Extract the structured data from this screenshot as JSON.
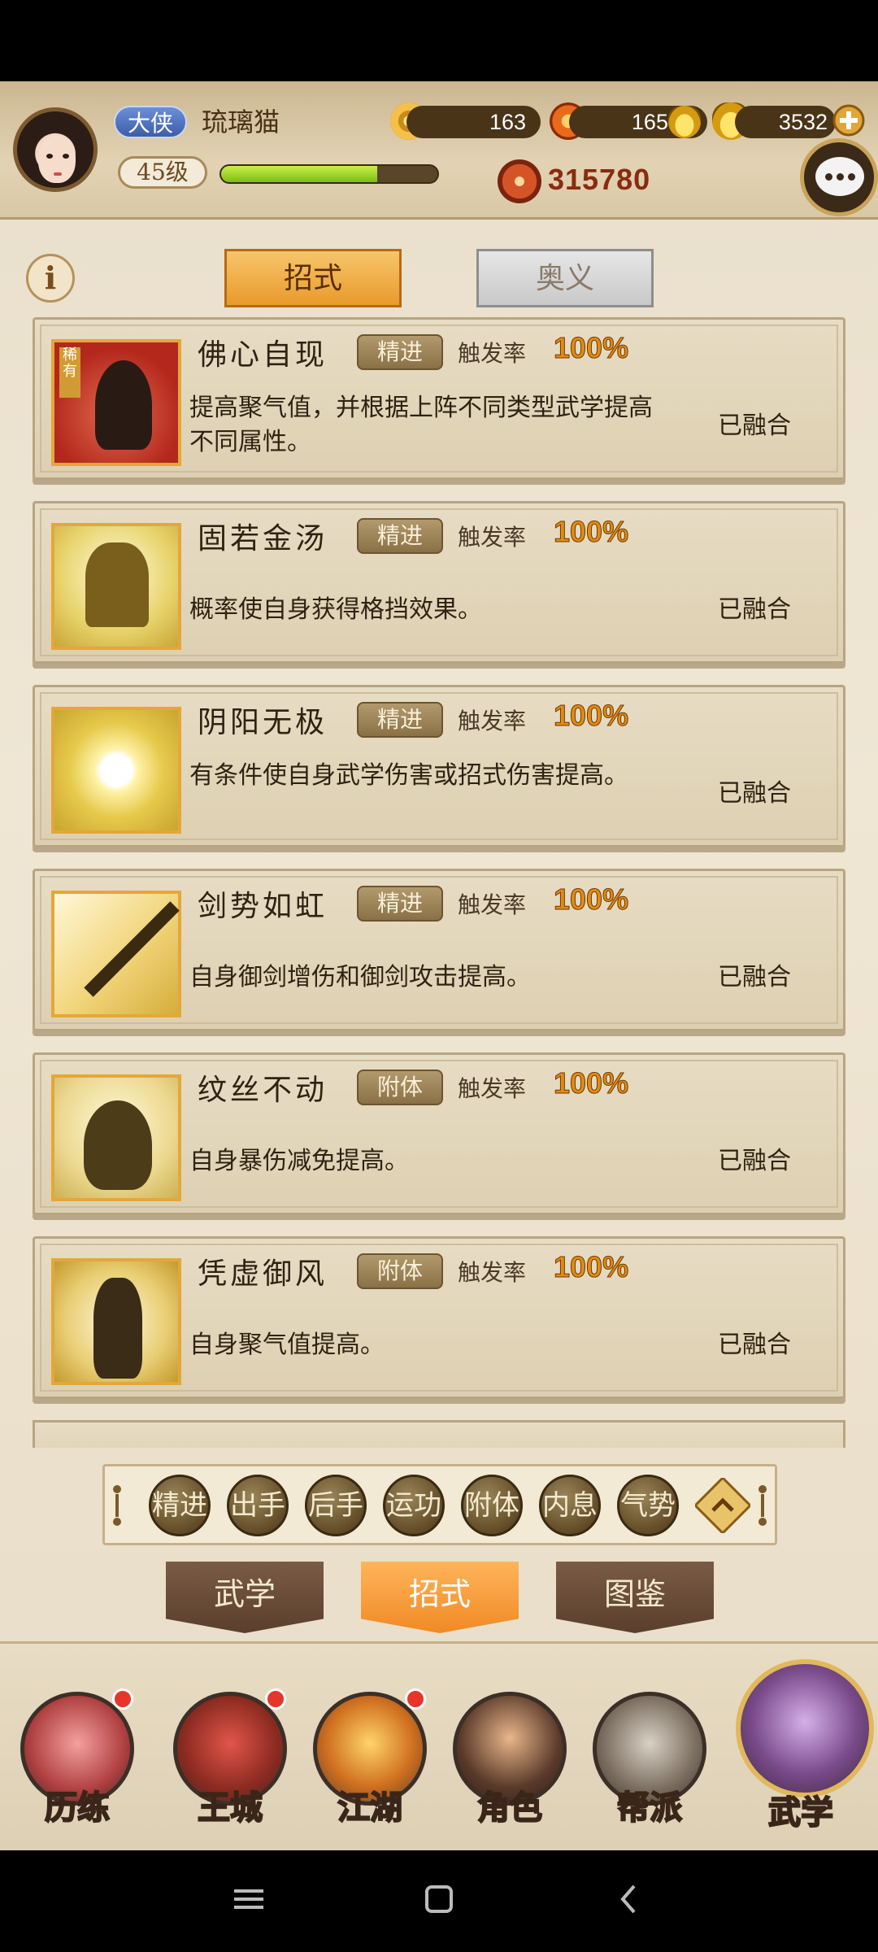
{
  "player": {
    "rank": "大侠",
    "name": "琉璃猫",
    "level": "45级",
    "exp_fraction": 0.72,
    "power": "315780"
  },
  "resources": {
    "coins": "163",
    "gems": "16502",
    "gold": "3532"
  },
  "tabs": {
    "top": [
      "招式",
      "奥义"
    ],
    "top_active": "招式"
  },
  "skills": [
    {
      "name": "佛心自现",
      "type": "精进",
      "trigger_label": "触发率",
      "trigger_value": "100%",
      "description": "提高聚气值，并根据上阵不同类型武学提高不同属性。",
      "status": "已融合",
      "rarity": "稀有",
      "icon": "praying-hands-icon"
    },
    {
      "name": "固若金汤",
      "type": "精进",
      "trigger_label": "触发率",
      "trigger_value": "100%",
      "description": "概率使自身获得格挡效果。",
      "status": "已融合",
      "icon": "bell-icon"
    },
    {
      "name": "阴阳无极",
      "type": "精进",
      "trigger_label": "触发率",
      "trigger_value": "100%",
      "description": "有条件使自身武学伤害或招式伤害提高。",
      "status": "已融合",
      "icon": "swirl-icon"
    },
    {
      "name": "剑势如虹",
      "type": "精进",
      "trigger_label": "触发率",
      "trigger_value": "100%",
      "description": "自身御剑增伤和御剑攻击提高。",
      "status": "已融合",
      "icon": "sword-icon"
    },
    {
      "name": "纹丝不动",
      "type": "附体",
      "trigger_label": "触发率",
      "trigger_value": "100%",
      "description": "自身暴伤减免提高。",
      "status": "已融合",
      "icon": "meditation-icon"
    },
    {
      "name": "凭虚御风",
      "type": "附体",
      "trigger_label": "触发率",
      "trigger_value": "100%",
      "description": "自身聚气值提高。",
      "status": "已融合",
      "icon": "wind-figure-icon"
    }
  ],
  "filters": [
    "精进",
    "出手",
    "后手",
    "运功",
    "附体",
    "内息",
    "气势"
  ],
  "sub_tabs": [
    "武学",
    "招式",
    "图鉴"
  ],
  "sub_tab_active": "招式",
  "bottom_nav": [
    {
      "label": "历练",
      "badge": true
    },
    {
      "label": "王城",
      "badge": true
    },
    {
      "label": "江湖",
      "badge": true
    },
    {
      "label": "角色",
      "badge": false
    },
    {
      "label": "帮派",
      "badge": false
    },
    {
      "label": "武学",
      "badge": false
    }
  ],
  "colors": {
    "accent": "#e99a2c",
    "trigger": "#e48a12",
    "badge": "#e8352a"
  }
}
